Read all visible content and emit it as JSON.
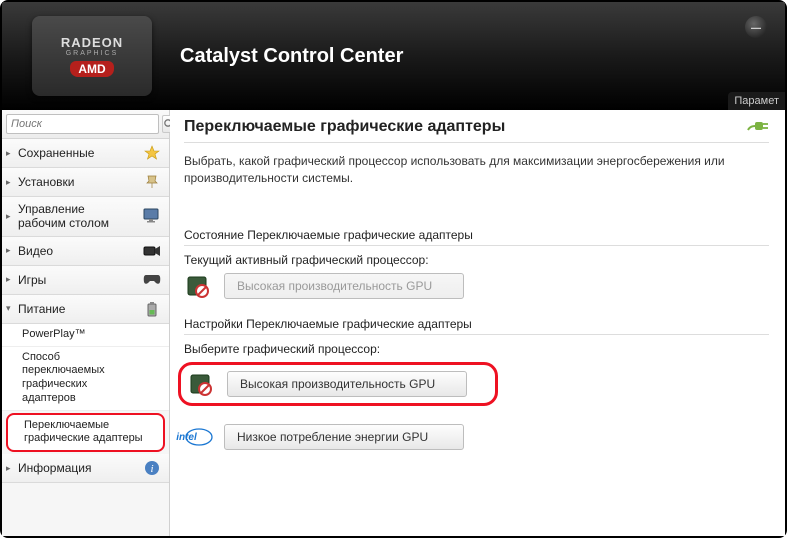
{
  "header": {
    "title": "Catalyst Control Center",
    "logo_top": "RADEON",
    "logo_sub": "GRAPHICS",
    "logo_brand": "AMD",
    "params": "Парамет"
  },
  "search": {
    "placeholder": "Поиск"
  },
  "nav": {
    "saved": "Сохраненные",
    "installs": "Установки",
    "desktop_mgmt_l1": "Управление",
    "desktop_mgmt_l2": "рабочим столом",
    "video": "Видео",
    "games": "Игры",
    "power": "Питание",
    "info": "Информация"
  },
  "power_sub": {
    "powerplay": "PowerPlay™",
    "method_l1": "Способ",
    "method_l2": "переключаемых",
    "method_l3": "графических",
    "method_l4": "адаптеров",
    "switchable_l1": "Переключаемые",
    "switchable_l2": "графические адаптеры"
  },
  "content": {
    "title": "Переключаемые графические адаптеры",
    "description": "Выбрать, какой графический процессор использовать для максимизации энергосбережения или производительности системы.",
    "state_h": "Состояние Переключаемые графические адаптеры",
    "current_label": "Текущий активный графический процессор:",
    "current_btn": "Высокая производительность GPU",
    "settings_h": "Настройки Переключаемые графические адаптеры",
    "select_label": "Выберите графический процессор:",
    "high_btn": "Высокая производительность GPU",
    "low_btn": "Низкое потребление энергии GPU",
    "intel": "intel"
  }
}
